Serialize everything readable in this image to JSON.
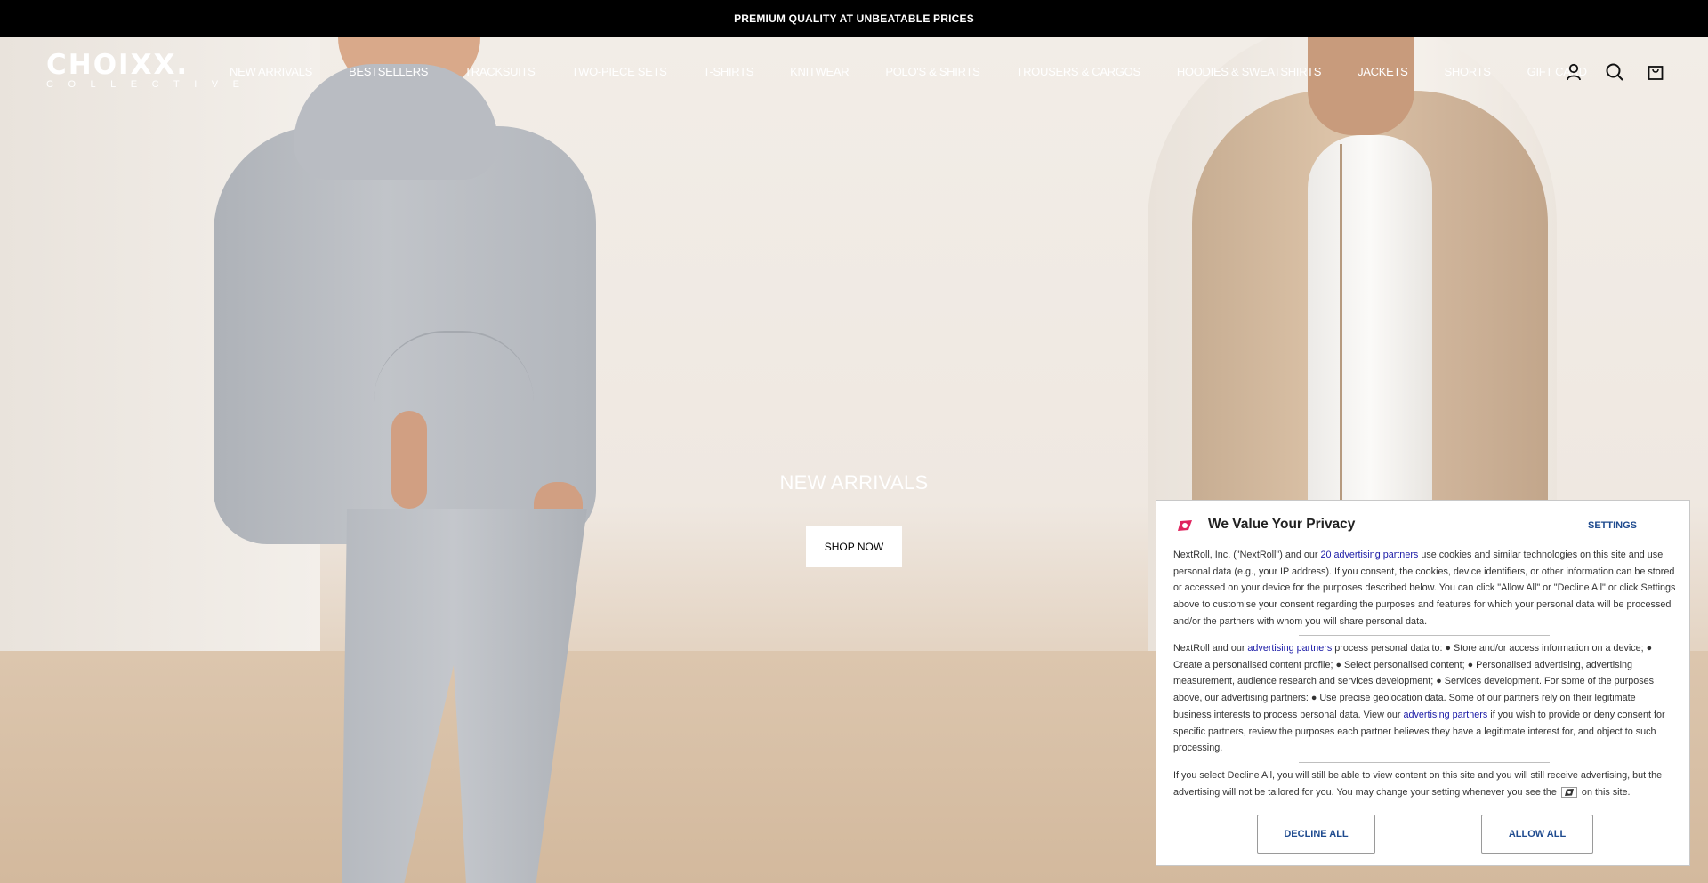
{
  "announcement": {
    "text": "PREMIUM QUALITY AT UNBEATABLE PRICES"
  },
  "brand": {
    "name": "CHOIXX.",
    "tagline": "COLLECTIVE"
  },
  "nav": {
    "items": [
      "NEW ARRIVALS",
      "BESTSELLERS",
      "TRACKSUITS",
      "TWO-PIECE SETS",
      "T-SHIRTS",
      "KNITWEAR",
      "POLO'S & SHIRTS",
      "TROUSERS & CARGOS",
      "HOODIES & SWEATSHIRTS",
      "JACKETS",
      "SHORTS",
      "GIFT CARD"
    ]
  },
  "header_icons": [
    "account-icon",
    "search-icon",
    "cart-icon"
  ],
  "hero": {
    "title": "NEW ARRIVALS",
    "cta": "SHOP NOW"
  },
  "consent": {
    "title": "We Value Your Privacy",
    "settings_label": "SETTINGS",
    "p1_before": "NextRoll, Inc. (\"NextRoll\") and our ",
    "p1_link": "20 advertising partners",
    "p1_after": " use cookies and similar technologies on this site and use personal data (e.g., your IP address). If you consent, the cookies, device identifiers, or other information can be stored or accessed on your device for the purposes described below. You can click \"Allow All\" or \"Decline All\" or click Settings above to customise your consent regarding the purposes and features for which your personal data will be processed and/or the partners with whom you will share personal data.",
    "p2_before": "NextRoll and our ",
    "p2_link1": "advertising partners",
    "p2_middle": " process personal data to: ● Store and/or access information on a device; ● Create a personalised content profile; ● Select personalised content; ● Personalised advertising, advertising measurement, audience research and services development; ● Services development. For some of the purposes above, our advertising partners: ● Use precise geolocation data. Some of our partners rely on their legitimate business interests to process personal data. View our ",
    "p2_link2": "advertising partners",
    "p2_after": " if you wish to provide or deny consent for specific partners, review the purposes each partner believes they have a legitimate interest for, and object to such processing.",
    "p3_before": "If you select Decline All, you will still be able to view content on this site and you will still receive advertising, but the advertising will not be tailored for you. You may change your setting whenever you see the ",
    "p3_after": " on this site.",
    "decline_label": "DECLINE ALL",
    "allow_label": "ALLOW ALL",
    "accent_color": "#e0245e"
  }
}
